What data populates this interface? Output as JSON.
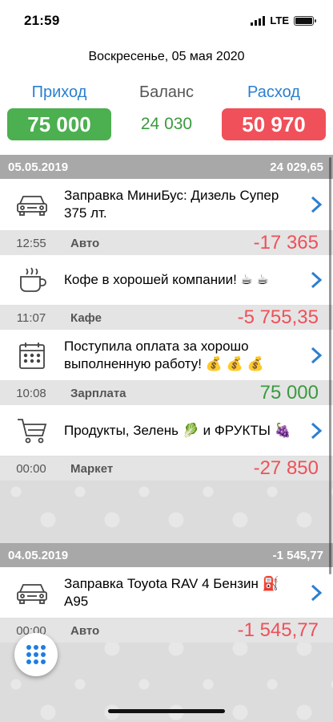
{
  "status_bar": {
    "time": "21:59",
    "network": "LTE"
  },
  "header": {
    "date": "Воскресенье, 05 мая 2020"
  },
  "summary": {
    "income_label": "Приход",
    "income_value": "75 000",
    "balance_label": "Баланс",
    "balance_value": "24 030",
    "expense_label": "Расход",
    "expense_value": "50 970"
  },
  "days": [
    {
      "date": "05.05.2019",
      "total": "24 029,65",
      "transactions": [
        {
          "icon": "car-icon",
          "title": "Заправка МиниБус: Дизель Супер 375 лт.",
          "time": "12:55",
          "category": "Авто",
          "amount": "-17 365",
          "type": "expense"
        },
        {
          "icon": "coffee-cup-icon",
          "title": "Кофе в хорошей компании! ☕ ☕",
          "time": "11:07",
          "category": "Кафе",
          "amount": "-5 755,35",
          "type": "expense"
        },
        {
          "icon": "calendar-icon",
          "title": "Поступила оплата за хорошо выполненную работу! 💰 💰 💰",
          "time": "10:08",
          "category": "Зарплата",
          "amount": "75 000",
          "type": "income"
        },
        {
          "icon": "shopping-cart-icon",
          "title": "Продукты, Зелень 🥬 и ФРУКТЫ 🍇",
          "time": "00:00",
          "category": "Маркет",
          "amount": "-27 850",
          "type": "expense"
        }
      ]
    },
    {
      "date": "04.05.2019",
      "total": "-1 545,77",
      "transactions": [
        {
          "icon": "car-icon",
          "title": "Заправка Toyota RAV 4  Бензин ⛽ А95",
          "time": "00:00",
          "category": "Авто",
          "amount": "-1 545,77",
          "type": "expense"
        }
      ]
    }
  ],
  "colors": {
    "income": "#4caf50",
    "expense": "#f0505a",
    "link": "#2b7fd0",
    "day_header": "#a8a8a8"
  },
  "fab": {
    "icon": "grid-dots-icon"
  }
}
